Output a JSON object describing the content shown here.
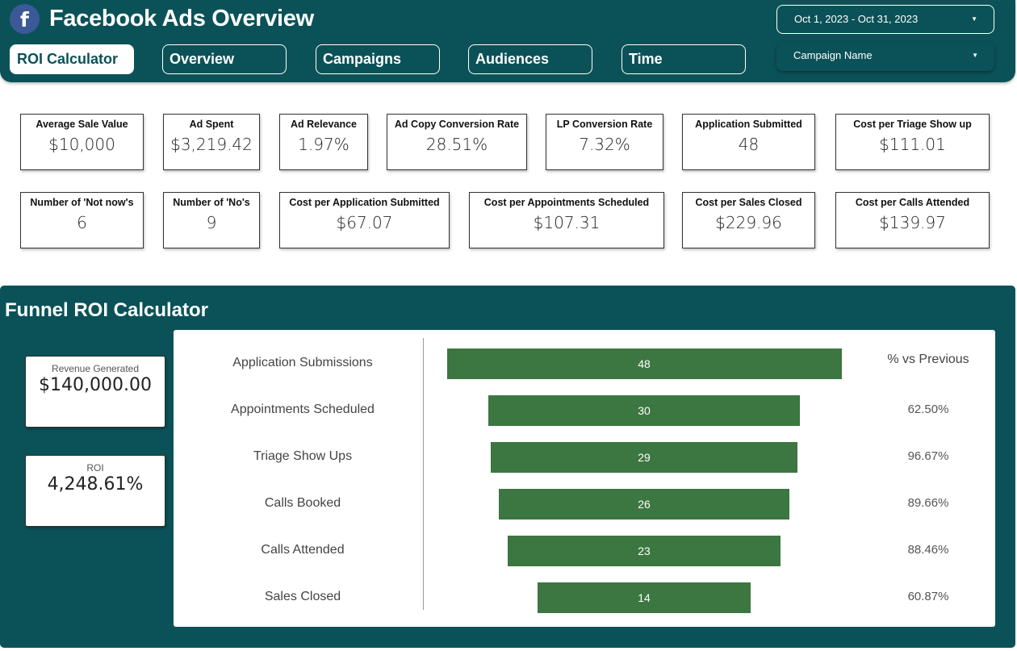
{
  "header": {
    "logo_glyph": "f",
    "title": "Facebook Ads Overview",
    "tabs": [
      "ROI Calculator",
      "Overview",
      "Campaigns",
      "Audiences",
      "Time"
    ],
    "date_range": "Oct 1, 2023 - Oct 31, 2023",
    "campaign_filter": "Campaign Name",
    "caret_glyph": "▼"
  },
  "kpis": {
    "avg_sale_value": {
      "label": "Average Sale Value",
      "value": "$10,000"
    },
    "ad_spent": {
      "label": "Ad Spent",
      "value": "$3,219.42"
    },
    "ad_relevance": {
      "label": "Ad Relevance",
      "value": "1.97%"
    },
    "ad_copy_conv": {
      "label": "Ad Copy Conversion Rate",
      "value": "28.51%"
    },
    "lp_conv": {
      "label": "LP Conversion Rate",
      "value": "7.32%"
    },
    "app_submitted": {
      "label": "Application Submitted",
      "value": "48"
    },
    "cost_triage": {
      "label": "Cost per Triage Show up",
      "value": "$111.01"
    },
    "not_nows": {
      "label": "Number of 'Not now's",
      "value": "6"
    },
    "nos": {
      "label": "Number of 'No's",
      "value": "9"
    },
    "cost_app": {
      "label": "Cost per Application Submitted",
      "value": "$67.07"
    },
    "cost_appt": {
      "label": "Cost per Appointments Scheduled",
      "value": "$107.31"
    },
    "cost_sales": {
      "label": "Cost per Sales Closed",
      "value": "$229.96"
    },
    "cost_calls": {
      "label": "Cost per Calls Attended",
      "value": "$139.97"
    }
  },
  "funnel": {
    "title": "Funnel ROI Calculator",
    "revenue": {
      "label": "Revenue Generated",
      "value": "$140,000.00"
    },
    "roi": {
      "label": "ROI",
      "value": "4,248.61%"
    },
    "pct_header": "% vs Previous",
    "colors": {
      "bar": "#3c7641",
      "section": "#0b5258"
    }
  },
  "chart_data": {
    "type": "bar",
    "orientation": "funnel",
    "categories": [
      "Application Submissions",
      "Appointments Scheduled",
      "Triage Show Ups",
      "Calls Booked",
      "Calls Attended",
      "Sales Closed"
    ],
    "values": [
      48,
      30,
      29,
      26,
      23,
      14
    ],
    "pct_vs_previous": [
      "",
      "62.50%",
      "96.67%",
      "89.66%",
      "88.46%",
      "60.87%"
    ]
  }
}
